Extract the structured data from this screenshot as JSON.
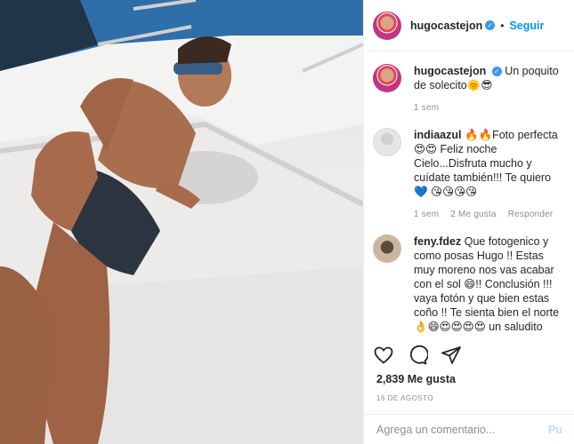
{
  "post": {
    "username": "hugocastejon",
    "follow_label": "Seguir",
    "separator": "•"
  },
  "caption": {
    "username": "hugocastejon",
    "text": "Un poquito de solecito",
    "emojis": "🌞😎",
    "time": "1 sem"
  },
  "comments": [
    {
      "username": "indiaazul",
      "text": "🔥🔥Foto perfecta 😍😍 Feliz noche Cielo...Disfruta mucho y cuídate también!!! Te quiero 💙 😘😘😘😘",
      "time": "1 sem",
      "likes": "2 Me gusta",
      "reply": "Responder"
    },
    {
      "username": "feny.fdez",
      "text": "Que fotogenico y como posas Hugo !! Estas muy moreno nos vas acabar con el sol 😄!! Conclusión !!! vaya fotón y que bien estas coño !! Te sienta bien el norte 👌😄😍😍😍😍 un saludito",
      "time": "",
      "likes": "",
      "reply": ""
    }
  ],
  "stats": {
    "likes": "2,839 Me gusta",
    "date": "16 DE AGOSTO"
  },
  "add_comment": {
    "placeholder": "Agrega un comentario...",
    "publish_label": "Pu"
  },
  "icons": {
    "like": "heart-icon",
    "comment": "comment-icon",
    "share": "share-icon"
  },
  "colors": {
    "link_blue": "#0095f6",
    "verified_blue": "#3897f0",
    "muted": "#8e8e8e"
  }
}
